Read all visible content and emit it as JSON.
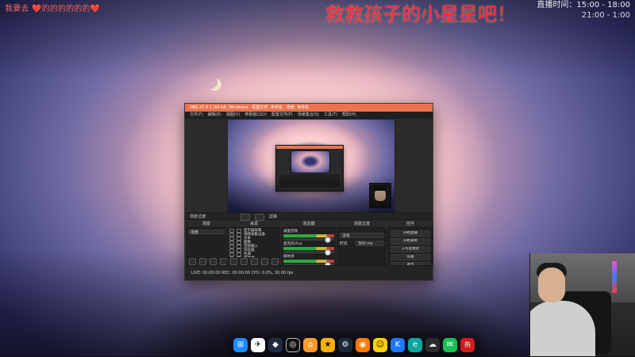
{
  "overlay": {
    "left_text": "我要去 ❤️的的的的的的❤️",
    "center_text": "救救孩子的小星星吧！",
    "right_line1": "直播时间：15:00 - 18:00",
    "right_line2": "21:00 - 1:00"
  },
  "obs": {
    "title": "OBS 27.0.1 (64-bit, Windows) - 配置文件: 未命名 - 场景: 未命名",
    "menu": [
      "文件(F)",
      "编辑(E)",
      "视图(V)",
      "停靠窗口(D)",
      "配置文件(P)",
      "场景集合(S)",
      "工具(T)",
      "帮助(H)"
    ],
    "mini_toolbar": {
      "left_label": "场景过渡",
      "right_label": "滤镜"
    },
    "docks": {
      "scenes": {
        "title": "场景",
        "items": [
          "场景"
        ]
      },
      "sources": {
        "title": "来源",
        "items": [
          "显示器采集",
          "视频采集设备",
          "文本",
          "图像",
          "音频输入",
          "浏览器",
          "色源",
          "媒体源",
          "窗口采集"
        ]
      },
      "mixer": {
        "title": "混音器",
        "tracks": [
          {
            "name": "桌面音频",
            "value": "0.0 dB"
          },
          {
            "name": "麦克风/Aux",
            "value": "0.0 dB"
          },
          {
            "name": "媒体源",
            "value": "0.0 dB"
          }
        ]
      },
      "transitions": {
        "title": "场景过渡",
        "type_label": "淡化",
        "duration_label": "时长",
        "duration_value": "300 ms"
      },
      "controls": {
        "title": "控件",
        "buttons": [
          "开始直播",
          "开始录制",
          "工作室模式",
          "设置",
          "退出"
        ]
      }
    },
    "status": "LIVE: 00:00:00   REC: 00:00:00   CPU: 0.0%, 30.00 fps"
  },
  "taskbar": {
    "items": [
      {
        "name": "windows-start-icon",
        "glyph": "⊞"
      },
      {
        "name": "app-icon",
        "glyph": "✈"
      },
      {
        "name": "app-icon",
        "glyph": "◆"
      },
      {
        "name": "obs-icon",
        "glyph": "◎"
      },
      {
        "name": "app-icon",
        "glyph": "⌂"
      },
      {
        "name": "app-icon",
        "glyph": "★"
      },
      {
        "name": "steam-icon",
        "glyph": "⚙"
      },
      {
        "name": "app-icon",
        "glyph": "◉"
      },
      {
        "name": "app-icon",
        "glyph": "☺"
      },
      {
        "name": "kugou-icon",
        "glyph": "K"
      },
      {
        "name": "edge-icon",
        "glyph": "e"
      },
      {
        "name": "app-icon",
        "glyph": "☁"
      },
      {
        "name": "wechat-icon",
        "glyph": "✉"
      },
      {
        "name": "app-icon",
        "glyph": "热"
      }
    ]
  }
}
